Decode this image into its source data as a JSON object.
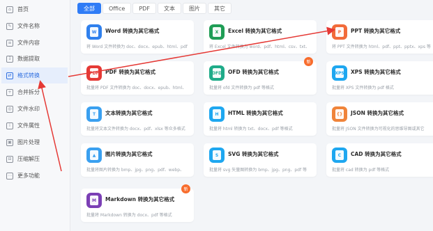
{
  "sidebar": {
    "items": [
      {
        "label": "首页",
        "icon": "home-icon",
        "glyph": "⌂"
      },
      {
        "label": "文件名称",
        "icon": "file-name-icon",
        "glyph": "✎"
      },
      {
        "label": "文件内容",
        "icon": "file-content-icon",
        "glyph": "≡"
      },
      {
        "label": "数据提取",
        "icon": "data-extract-icon",
        "glyph": "↧"
      },
      {
        "label": "格式转换",
        "icon": "format-convert-icon",
        "glyph": "⇄"
      },
      {
        "label": "合并拆分",
        "icon": "merge-split-icon",
        "glyph": "+"
      },
      {
        "label": "文件水印",
        "icon": "watermark-icon",
        "glyph": "◎"
      },
      {
        "label": "文件属性",
        "icon": "file-props-icon",
        "glyph": "i"
      },
      {
        "label": "图片处理",
        "icon": "image-process-icon",
        "glyph": "▣"
      },
      {
        "label": "压缩解压",
        "icon": "compress-icon",
        "glyph": "⊟"
      },
      {
        "label": "更多功能",
        "icon": "more-icon",
        "glyph": "⋯"
      }
    ],
    "active": "格式转换"
  },
  "tabs": [
    {
      "label": "全部",
      "active": true
    },
    {
      "label": "Office",
      "active": false
    },
    {
      "label": "PDF",
      "active": false
    },
    {
      "label": "文本",
      "active": false
    },
    {
      "label": "图片",
      "active": false
    },
    {
      "label": "其它",
      "active": false
    }
  ],
  "cards": [
    {
      "title": "Word 转换为其它格式",
      "desc": "将 Word 文件转换为 doc、docx、epub、html、pdf",
      "icon": "word-icon",
      "glyph": "W",
      "color": "#2f80ed",
      "badge": ""
    },
    {
      "title": "Excel 转换为其它格式",
      "desc": "将 Excel 文件转换为 word、pdf、html、csv、txt、",
      "icon": "excel-icon",
      "glyph": "X",
      "color": "#1f9d55",
      "badge": ""
    },
    {
      "title": "PPT 转换为其它格式",
      "desc": "将 PPT 文件转换为 html、pdf、ppt、pptx、xps 等",
      "icon": "ppt-icon",
      "glyph": "P",
      "color": "#f26b3a",
      "badge": ""
    },
    {
      "title": "PDF 转换为其它格式",
      "desc": "批量将 PDF 文件转换为 doc、docx、epub、html、",
      "icon": "pdf-icon",
      "glyph": "PDF",
      "color": "#e53935",
      "badge": ""
    },
    {
      "title": "OFD 转换为其它格式",
      "desc": "批量将 ofd 文件转换为 pdf 等格式",
      "icon": "ofd-icon",
      "glyph": "OFD",
      "color": "#1fab89",
      "badge": "新"
    },
    {
      "title": "XPS 转换为其它格式",
      "desc": "批量将 XPS 文件转换为 pdf 格式",
      "icon": "xps-icon",
      "glyph": "XPS",
      "color": "#1ea7f0",
      "badge": ""
    },
    {
      "title": "文本转换为其它格式",
      "desc": "批量将文本文件转换为 docx、pdf、xlsx 等众多格式",
      "icon": "text-icon",
      "glyph": "T",
      "color": "#3aa0f0",
      "badge": ""
    },
    {
      "title": "HTML 转换为其它格式",
      "desc": "批量将 html 转换为 txt、docx、pdf 等格式",
      "icon": "html-icon",
      "glyph": "H",
      "color": "#1ea7f0",
      "badge": ""
    },
    {
      "title": "JSON 转换为其它格式",
      "desc": "批量将 JSON 文件转换为可视化的思维导图或其它",
      "icon": "json-icon",
      "glyph": "{}",
      "color": "#f0843a",
      "badge": ""
    },
    {
      "title": "图片转换为其它格式",
      "desc": "批量将图片转换为 bmp、jpg、png、pdf、webp、",
      "icon": "image-icon",
      "glyph": "▲",
      "color": "#3aa0f0",
      "badge": ""
    },
    {
      "title": "SVG 转换为其它格式",
      "desc": "批量将 svg 矢量图转换为 bmp、jpg、png、pdf 等",
      "icon": "svg-icon",
      "glyph": "S",
      "color": "#1ea7f0",
      "badge": ""
    },
    {
      "title": "CAD 转换为其它格式",
      "desc": "批量将 cad 转换为 pdf 等格式",
      "icon": "cad-icon",
      "glyph": "C",
      "color": "#1ea7f0",
      "badge": ""
    },
    {
      "title": "Markdown 转换为其它格式",
      "desc": "批量将 Markdown 转换为 docx、pdf 等格式",
      "icon": "markdown-icon",
      "glyph": "M",
      "color": "#7b3fb5",
      "badge": "新"
    }
  ],
  "annotation_color": "#e53935"
}
